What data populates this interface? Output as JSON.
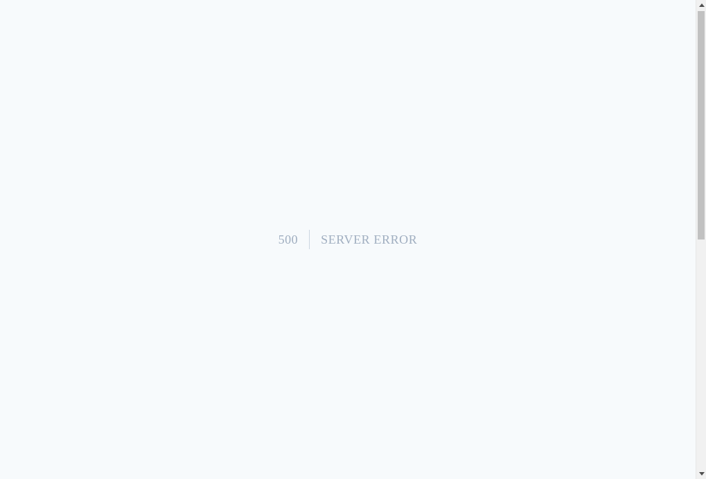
{
  "error": {
    "code": "500",
    "message": "SERVER ERROR"
  },
  "colors": {
    "background": "#f7fafc",
    "text": "#a0aec0",
    "divider": "#cbd5e0",
    "scrollbar_track": "#f1f1f1",
    "scrollbar_thumb": "#c1c1c1"
  },
  "scrollbar": {
    "up_icon": "triangle-up-icon",
    "down_icon": "triangle-down-icon"
  }
}
